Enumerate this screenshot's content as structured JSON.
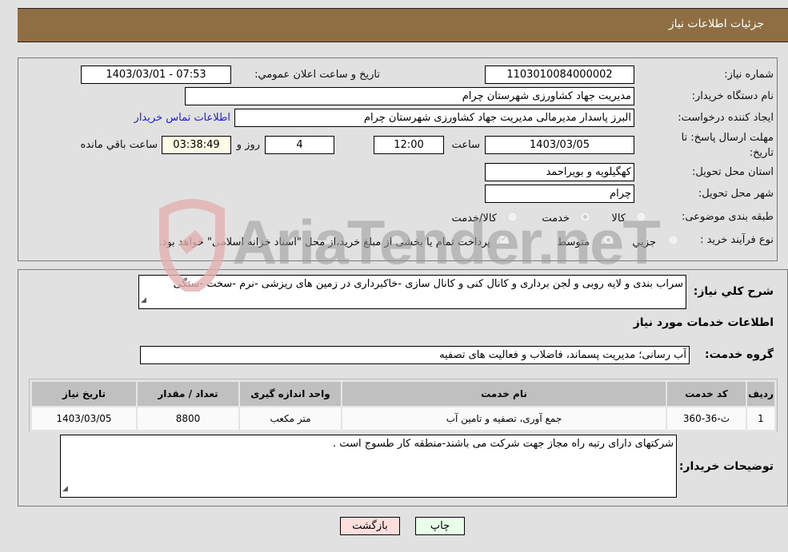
{
  "header": {
    "title": "جزئیات اطلاعات نیاز"
  },
  "form": {
    "need_number": {
      "label": "شماره نیاز:",
      "value": "1103010084000002"
    },
    "announce_datetime": {
      "label": "تاریخ و ساعت اعلان عمومي:",
      "value": "1403/03/01 - 07:53"
    },
    "buyer_org": {
      "label": "نام دستگاه خریدار:",
      "value": "مدیریت جهاد کشاورزی شهرستان چرام"
    },
    "requester": {
      "label": "ایجاد کننده درخواست:",
      "value": "البرز پاسدار مدیرمالی مدیریت جهاد کشاورزی شهرستان چرام"
    },
    "buyer_contact_link": "اطلاعات تماس خریدار",
    "deadline": {
      "label": "مهلت ارسال پاسخ: تا تاریخ:",
      "date": "1403/03/05",
      "time_label": "ساعت",
      "time": "12:00",
      "days": "4",
      "days_label": "روز و",
      "remaining": "03:38:49",
      "remaining_label": "ساعت باقي مانده"
    },
    "province": {
      "label": "استان محل تحویل:",
      "value": "کهگیلویه و بویراحمد"
    },
    "city": {
      "label": "شهر محل تحویل:",
      "value": "چرام"
    },
    "category": {
      "label": "طبقه بندی موضوعی:",
      "options": [
        "کالا",
        "خدمت",
        "کالا/خدمت"
      ],
      "selected": "خدمت"
    },
    "purchase_type": {
      "label": "نوع فرآیند خرید :",
      "options": [
        "جزيي",
        "متوسط"
      ],
      "selected": "متوسط",
      "treasury_note": "پرداخت تمام یا بخشی از مبلغ خرید،از محل \"اسناد خزانه اسلامی\" خواهد بود."
    }
  },
  "description": {
    "label": "شرح کلي نياز:",
    "value": "سراب بندی و لایه روبی و لجن برداری و کانال کنی و کانال سازی -خاکبرداری  در زمین های ریزشی -نرم -سخت -سنگی"
  },
  "services": {
    "section_title": "اطلاعات خدمات مورد نياز",
    "group_label": "گروه خدمت:",
    "group_value": "آب رسانی؛ مدیریت پسماند، فاضلاب و فعالیت های تصفیه",
    "table": {
      "headers": [
        "رديف",
        "کد خدمت",
        "نام خدمت",
        "واحد اندازه گيری",
        "تعداد / مقدار",
        "تاريخ نياز"
      ],
      "rows": [
        [
          "1",
          "ث-36-360",
          "جمع آوری، تصفیه و تامین آب",
          "متر مکعب",
          "8800",
          "1403/03/05"
        ]
      ]
    }
  },
  "buyer_notes": {
    "label": "توضيحات خريدار:",
    "value": "شرکتهای دارای رتبه راه مجاز جهت شرکت می باشند-منطقه کار طسوج است ."
  },
  "buttons": {
    "print": "چاپ",
    "back": "بازگشت"
  },
  "watermark": {
    "text": "AriaTender.neT"
  },
  "colors": {
    "header_bg": "#8e6e42",
    "print_bg": "#eaffea",
    "back_bg": "#ffdede",
    "link": "#2020d0"
  }
}
